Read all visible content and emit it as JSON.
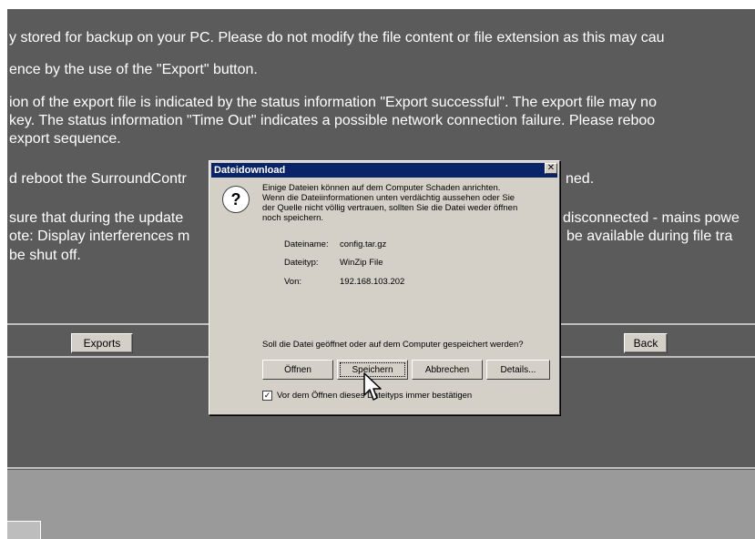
{
  "background": {
    "text_lines": [
      "y stored for backup on your PC. Please do not modify the file content or file extension as this may cau",
      "ence by the use of the \"Export\" button.",
      "ion of the export file is indicated by the status information \"Export successful\". The export file may no",
      " key. The status information \"Time Out\" indicates a possible network connection failure. Please reboo",
      "export sequence.",
      "d reboot the SurroundContr",
      "ned.",
      "sure that during the update",
      "disconnected - mains powe",
      "ote: Display interferences m",
      "be available during file tra",
      "be shut off."
    ],
    "exports_label": "Exports",
    "back_label": "Back"
  },
  "dialog": {
    "title": "Dateidownload",
    "close_symbol": "✕",
    "icon_symbol": "?",
    "warning": "Einige Dateien können auf dem Computer Schaden anrichten.\nWenn die Dateiinformationen unten verdächtig aussehen oder Sie\nder Quelle nicht völlig vertrauen, sollten Sie die Datei weder öffnen\nnoch speichern.",
    "name_label": "Dateiname:",
    "name_value": "config.tar.gz",
    "type_label": "Dateityp:",
    "type_value": "WinZip File",
    "from_label": "Von:",
    "from_value": "192.168.103.202",
    "question": "Soll die Datei geöffnet oder auf dem Computer gespeichert werden?",
    "buttons": {
      "open": "Öffnen",
      "save": "Speichern",
      "cancel": "Abbrechen",
      "details": "Details..."
    },
    "checkbox_label": "Vor dem Öffnen dieses Dateityps immer bestätigen",
    "checkbox_checked": true,
    "checkbox_mark": "✓"
  },
  "colors": {
    "screen_bg": "#5b5b5b",
    "titlebar": "#0a246a",
    "dialog_face": "#d4d0c8"
  }
}
